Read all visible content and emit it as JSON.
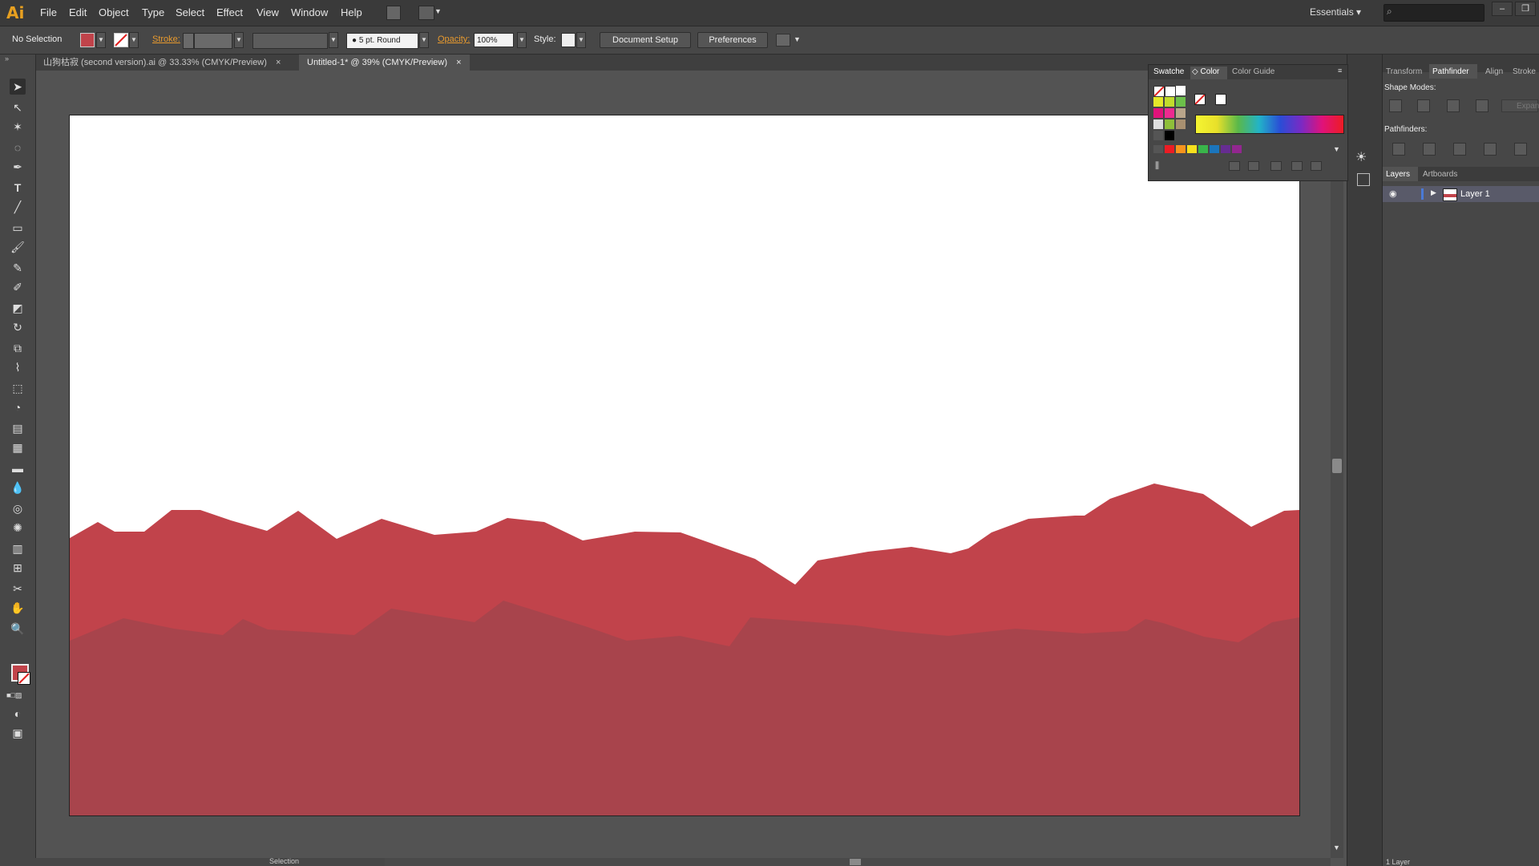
{
  "app": {
    "logo": "Ai"
  },
  "menu": [
    "File",
    "Edit",
    "Object",
    "Type",
    "Select",
    "Effect",
    "View",
    "Window",
    "Help"
  ],
  "workspace": {
    "label": "Essentials"
  },
  "control": {
    "selection_label": "No Selection",
    "stroke_label": "Stroke:",
    "brush_label": "5 pt. Round",
    "opacity_label": "Opacity:",
    "opacity_value": "100%",
    "style_label": "Style:",
    "document_setup": "Document Setup",
    "preferences": "Preferences",
    "fill_color": "#c0434a"
  },
  "tabs": [
    {
      "label": "山狗枯寂 (second version).ai @ 33.33% (CMYK/Preview)",
      "active": false
    },
    {
      "label": "Untitled-1* @ 39% (CMYK/Preview)",
      "active": true
    }
  ],
  "swatches_panel": {
    "tab_swatches": "Swatche",
    "tab_color": "Color",
    "tab_color_guide": "Color Guide"
  },
  "right_panel": {
    "tabs": [
      "Transform",
      "Pathfinder",
      "Align",
      "Stroke"
    ],
    "active_tab": "Pathfinder",
    "shape_modes": "Shape Modes:",
    "expand": "Expand",
    "pathfinders": "Pathfinders:",
    "layer_tabs": [
      "Layers",
      "Artboards"
    ],
    "layer_name": "Layer 1",
    "layer_count": "1 Layer"
  },
  "status": {
    "mode": "Selection"
  },
  "artwork": {
    "mountain_front_color": "#c1434b",
    "mountain_back_color": "#a8444c"
  }
}
